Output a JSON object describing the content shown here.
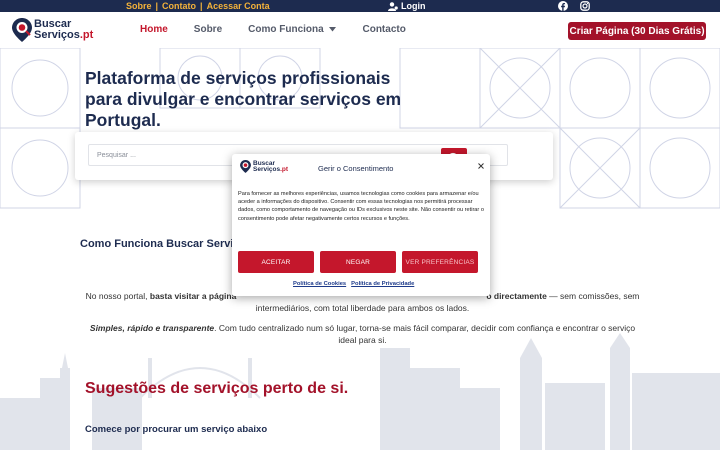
{
  "topbar": {
    "links": [
      "Sobre",
      "Contato",
      "Acessar Conta"
    ],
    "separator": "|",
    "login_label": "Login",
    "icons": [
      "facebook-icon",
      "instagram-icon"
    ]
  },
  "header": {
    "logo_line1": "Buscar",
    "logo_line2a": "Serviços",
    "logo_line2b": ".pt",
    "nav": {
      "home": "Home",
      "about": "Sobre",
      "how": "Como Funciona",
      "contact": "Contacto"
    },
    "cta": "Criar Página (30 Dias Grátis)"
  },
  "hero": {
    "title": "Plataforma de serviços profissionais para divulgar e encontrar serviços em Portugal.",
    "search_placeholder": "Pesquisar ..."
  },
  "content": {
    "how_title": "Como Funciona Buscar Servi",
    "para1_a": "No nosso portal, ",
    "para1_b": "basta visitar a página",
    "para1_c": "o directamente",
    "para1_d": " — sem comissões, sem intermediários, com total liberdade para ambos os lados.",
    "para2_a": "Simples, rápido e transparente",
    "para2_b": ". Com tudo centralizado num só lugar, torna-se mais fácil comparar, decidir com confiança e encontrar o serviço ideal para si.",
    "sugg_title": "Sugestões de serviços perto de si.",
    "sugg_sub": "Comece por procurar um serviço abaixo"
  },
  "consent": {
    "logo_line1": "Buscar",
    "logo_line2a": "Serviços",
    "logo_line2b": ".pt",
    "title": "Gerir o Consentimento",
    "body": "Para fornecer as melhores experiências, usamos tecnologias como cookies para armazenar e/ou aceder a informações do dispositivo. Consentir com essas tecnologias nos permitirá processar dados, como comportamento de navegação ou IDs exclusivos neste site. Não consentir ou retirar o consentimento pode afetar negativamente certos recursos e funções.",
    "accept": "ACEITAR",
    "deny": "NEGAR",
    "prefs": "VER PREFERÊNCIAS",
    "cookie_policy": "Política de Cookies",
    "privacy_policy": "Política de Privacidade"
  },
  "colors": {
    "navy": "#1d2b4f",
    "red": "#c4172c",
    "dark_red": "#a3122a",
    "gold": "#f3b23a"
  }
}
